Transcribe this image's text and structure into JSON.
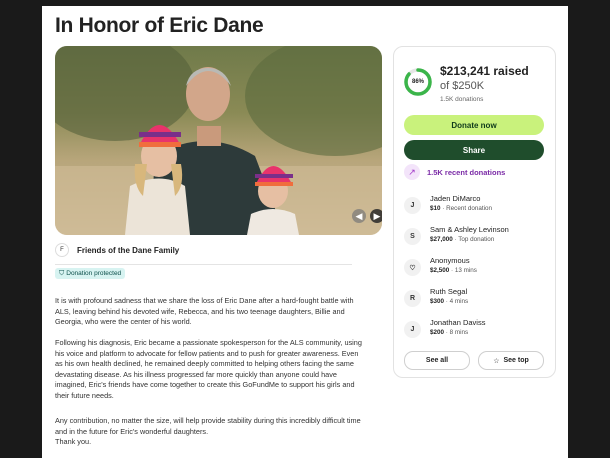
{
  "page": {
    "title": "In Honor of Eric Dane",
    "organizer": {
      "initial": "F",
      "name": "Friends of the Dane Family"
    },
    "badge": "Donation protected",
    "story": [
      "It is with profound sadness that we share the loss of Eric Dane after a hard-fought battle with ALS, leaving behind his devoted wife, Rebecca, and his two teenage daughters, Billie and Georgia, who were the center of his world.",
      "Following his diagnosis, Eric became a passionate spokesperson for the ALS community, using his voice and platform to advocate for fellow patients and to push for greater awareness. Even as his own health declined, he remained deeply committed to helping others facing the same devastating disease. As his illness progressed far more quickly than anyone could have imagined, Eric's friends have come together to create this GoFundMe to support his girls and their future needs.",
      "Any contribution, no matter the size, will help provide stability during this incredibly difficult time and in the future for Eric's wonderful daughters.",
      "Thank you."
    ]
  },
  "sidebar": {
    "percent_label": "86%",
    "progress": 0.86,
    "raised": "$213,241 raised",
    "goal": "of $250K",
    "donations": "1.5K donations",
    "donate_label": "Donate now",
    "share_label": "Share",
    "recent_label": "1.5K recent donations",
    "donors": [
      {
        "initial": "J",
        "name": "Jaden DiMarco",
        "amount": "$10",
        "note": "Recent donation"
      },
      {
        "initial": "S",
        "name": "Sam & Ashley Levinson",
        "amount": "$27,000",
        "note": "Top donation"
      },
      {
        "initial": "",
        "name": "Anonymous",
        "amount": "$2,500",
        "note": "13 mins"
      },
      {
        "initial": "R",
        "name": "Ruth Segal",
        "amount": "$300",
        "note": "4 mins"
      },
      {
        "initial": "J",
        "name": "Jonathan Daviss",
        "amount": "$200",
        "note": "8 mins"
      }
    ],
    "see_all_label": "See all",
    "see_top_label": "See top"
  },
  "colors": {
    "accent_green": "#c9f27c",
    "dark_green": "#1f4d2c",
    "progress_green": "#3bb54a",
    "purple": "#7a2aa6"
  }
}
